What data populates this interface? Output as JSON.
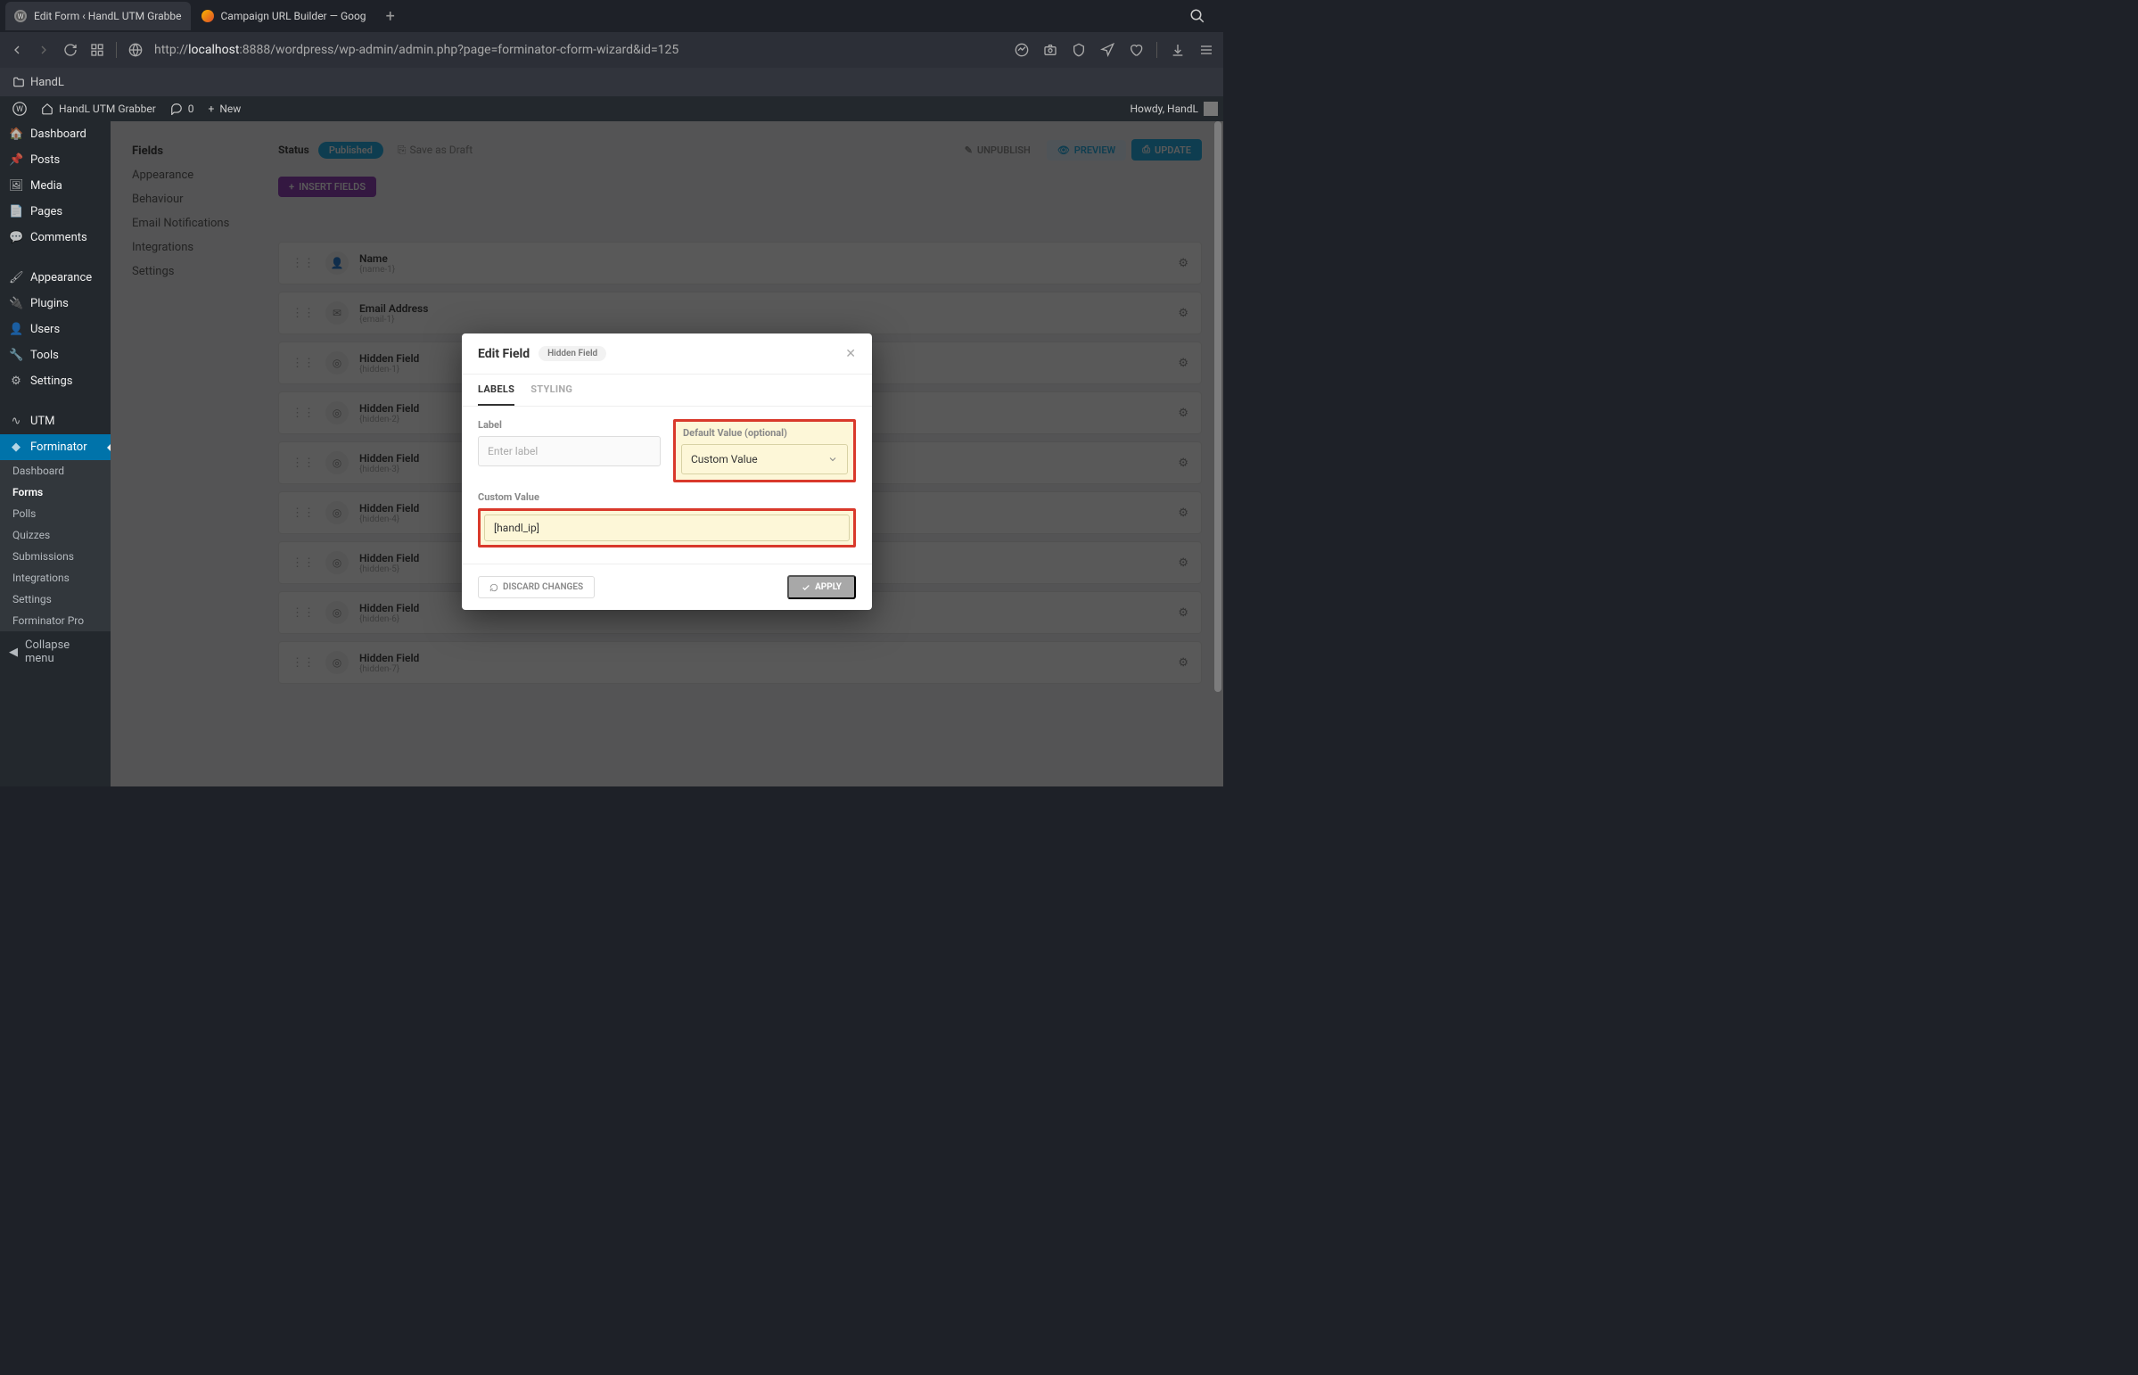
{
  "browser": {
    "tabs": [
      {
        "title": "Edit Form ‹ HandL UTM Grabbe",
        "active": true
      },
      {
        "title": "Campaign URL Builder — Goog",
        "active": false
      }
    ],
    "url_prefix": "http://",
    "url_host": "localhost",
    "url_path": ":8888/wordpress/wp-admin/admin.php?page=forminator-cform-wizard&id=125",
    "bookmark": "HandL"
  },
  "wp_adminbar": {
    "site": "HandL UTM Grabber",
    "comments": "0",
    "new": "New",
    "howdy": "Howdy, HandL"
  },
  "wp_menu": [
    {
      "icon": "🏠",
      "label": "Dashboard"
    },
    {
      "icon": "📌",
      "label": "Posts"
    },
    {
      "icon": "🖼",
      "label": "Media"
    },
    {
      "icon": "📄",
      "label": "Pages"
    },
    {
      "icon": "💬",
      "label": "Comments"
    },
    {
      "icon": "🖌",
      "label": "Appearance"
    },
    {
      "icon": "🔌",
      "label": "Plugins"
    },
    {
      "icon": "👤",
      "label": "Users"
    },
    {
      "icon": "🔧",
      "label": "Tools"
    },
    {
      "icon": "⚙",
      "label": "Settings"
    },
    {
      "icon": "∿",
      "label": "UTM"
    },
    {
      "icon": "◆",
      "label": "Forminator",
      "current": true
    }
  ],
  "wp_submenu": [
    {
      "label": "Dashboard"
    },
    {
      "label": "Forms",
      "current": true
    },
    {
      "label": "Polls"
    },
    {
      "label": "Quizzes"
    },
    {
      "label": "Submissions"
    },
    {
      "label": "Integrations"
    },
    {
      "label": "Settings"
    },
    {
      "label": "Forminator Pro"
    }
  ],
  "collapse_label": "Collapse menu",
  "side_tabs": [
    {
      "label": "Fields",
      "active": true
    },
    {
      "label": "Appearance"
    },
    {
      "label": "Behaviour"
    },
    {
      "label": "Email Notifications"
    },
    {
      "label": "Integrations"
    },
    {
      "label": "Settings"
    }
  ],
  "status": {
    "label": "Status",
    "pill": "Published",
    "save_draft": "Save as Draft",
    "unpublish": "UNPUBLISH",
    "preview": "PREVIEW",
    "update": "UPDATE"
  },
  "insert_fields": "INSERT FIELDS",
  "fields": [
    {
      "title": "Name",
      "sub": "{name-1}",
      "icon": "👤"
    },
    {
      "title": "Email Address",
      "sub": "{email-1}",
      "icon": "✉"
    },
    {
      "title": "Hidden Field",
      "sub": "{hidden-1}",
      "icon": "◎"
    },
    {
      "title": "Hidden Field",
      "sub": "{hidden-2}",
      "icon": "◎"
    },
    {
      "title": "Hidden Field",
      "sub": "{hidden-3}",
      "icon": "◎"
    },
    {
      "title": "Hidden Field",
      "sub": "{hidden-4}",
      "icon": "◎"
    },
    {
      "title": "Hidden Field",
      "sub": "{hidden-5}",
      "icon": "◎"
    },
    {
      "title": "Hidden Field",
      "sub": "{hidden-6}",
      "icon": "◎"
    },
    {
      "title": "Hidden Field",
      "sub": "{hidden-7}",
      "icon": "◎"
    }
  ],
  "modal": {
    "title": "Edit Field",
    "tag": "Hidden Field",
    "tabs": {
      "labels": "LABELS",
      "styling": "STYLING"
    },
    "label_label": "Label",
    "label_placeholder": "Enter label",
    "default_value_label": "Default Value (optional)",
    "default_value_selected": "Custom Value",
    "custom_value_label": "Custom Value",
    "custom_value": "[handl_ip]",
    "discard": "DISCARD CHANGES",
    "apply": "APPLY"
  }
}
